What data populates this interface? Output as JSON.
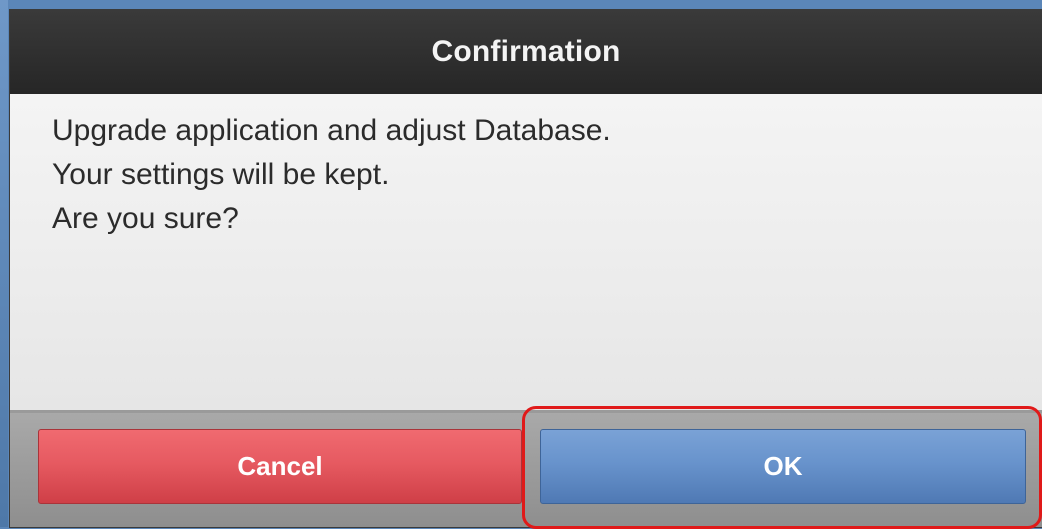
{
  "dialog": {
    "title": "Confirmation",
    "message_lines": [
      "Upgrade application and adjust Database.",
      "Your settings will be kept.",
      "Are you sure?"
    ]
  },
  "buttons": {
    "cancel_label": "Cancel",
    "ok_label": "OK"
  },
  "colors": {
    "title_bar": "#2e2e2e",
    "cancel_button": "#e65a61",
    "ok_button": "#6893cc",
    "highlight": "#e01919",
    "background": "#5b86b8"
  }
}
